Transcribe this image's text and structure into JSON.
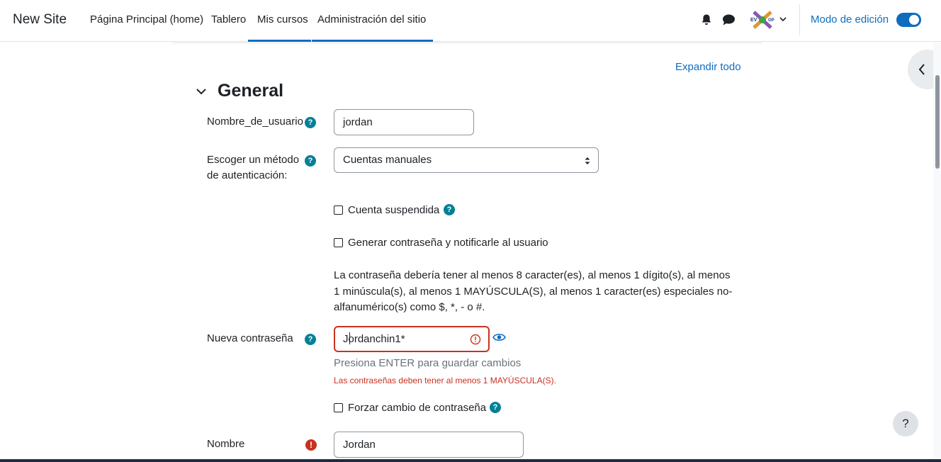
{
  "navbar": {
    "brand": "New Site",
    "items": [
      {
        "label": "Página Principal (home)"
      },
      {
        "label": "Tablero"
      },
      {
        "label": "Mis cursos"
      },
      {
        "label": "Administración del sitio"
      }
    ],
    "edit_mode_label": "Modo de edición",
    "edit_mode_on": true,
    "accent_color": "#0f6cbf"
  },
  "page": {
    "expand_all": "Expandir todo",
    "section_title": "General"
  },
  "form": {
    "username_label": "Nombre_de_usuario",
    "username_value": "jordan",
    "auth_label_1": "Escoger un método",
    "auth_label_2": "de autenticación:",
    "auth_value": "Cuentas manuales",
    "suspended_label": "Cuenta suspendida",
    "suspended_checked": false,
    "generate_label": "Generar contraseña y notificarle al usuario",
    "generate_checked": false,
    "policy_text": "La contraseña debería tener al menos 8 caracter(es), al menos 1 dígito(s), al menos 1 minúscula(s), al menos 1 MAYÚSCULA(S), al menos 1 caracter(es) especiales no-alfanumérico(s) como $, *, - o #.",
    "new_password_label": "Nueva contraseña",
    "new_password_value_prefix": "J",
    "new_password_value_rest": "ordanchin1*",
    "new_password_hint": "Presiona ENTER para guardar cambios",
    "new_password_error": "Las contraseñas deben tener al menos 1 MAYÚSCULA(S).",
    "force_change_label": "Forzar cambio de contraseña",
    "force_change_checked": false,
    "firstname_label": "Nombre",
    "firstname_value": "Jordan",
    "error_color": "#ca3120",
    "help_color": "#008196"
  },
  "help_fab": "?"
}
